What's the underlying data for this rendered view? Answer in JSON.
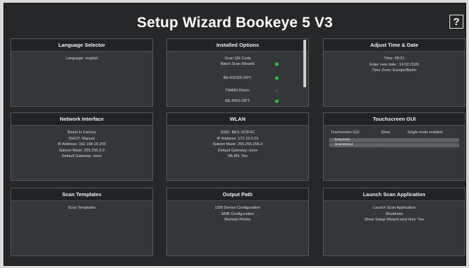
{
  "title": "Setup Wizard Bookeye 5 V3",
  "help_label": "?",
  "panels": {
    "language": {
      "header": "Language Selector",
      "lines": [
        "Language: english"
      ]
    },
    "installed": {
      "header": "Installed Options",
      "scan_qr": "Scan QR Code",
      "options": [
        {
          "label": "Batch Scan Wizard:",
          "status": "on"
        },
        {
          "label": "BE-KIOSK-OPT:",
          "status": "on"
        },
        {
          "label": "TWAIN Driver:",
          "status": "off"
        },
        {
          "label": "BE-PRO-OPT:",
          "status": "on"
        }
      ]
    },
    "time": {
      "header": "Adjust Time & Date",
      "lines": [
        "Time: 08:31",
        "Enter new date : 14.02.2020",
        "Time Zone: Europe/Berlin"
      ]
    },
    "network": {
      "header": "Network Interface",
      "lines": [
        "Reset to Factory",
        "DHCP: Manual",
        "IP Address: 192.168.16.205",
        "Subnet Mask: 255.255.0.0",
        "Default Gateway: none"
      ]
    },
    "wlan": {
      "header": "WLAN",
      "lines": [
        "SSID: BES-1F2F4C",
        "IP Address: 172.16.0.01",
        "Subnet Mask: 255.255.255.0",
        "Default Gateway: none",
        "WLAN: Yes"
      ]
    },
    "touch": {
      "header": "Touchscreen GUI",
      "col_gui": "Touchscreen GUI",
      "col_show": "Show",
      "col_single": "Single mode enabled",
      "rows": [
        {
          "name": "EasyScan",
          "show": "",
          "single": ""
        },
        {
          "name": "ScanWizard",
          "show": "-",
          "single": "-"
        }
      ]
    },
    "templates": {
      "header": "Scan Templates",
      "lines": [
        "Scan Templates"
      ]
    },
    "output": {
      "header": "Output Path",
      "lines": [
        "USB Device Configuration",
        "SMB Configuration",
        "Remote Printer"
      ]
    },
    "launch": {
      "header": "Launch Scan Application",
      "lines": [
        "Launch Scan Application",
        "Shutdown",
        "Show Setup Wizard next time: Yes"
      ]
    }
  },
  "colors": {
    "background": "#252729",
    "panel": "#33373a",
    "panel_header": "#1f2326",
    "status_on": "#2bd23a"
  }
}
